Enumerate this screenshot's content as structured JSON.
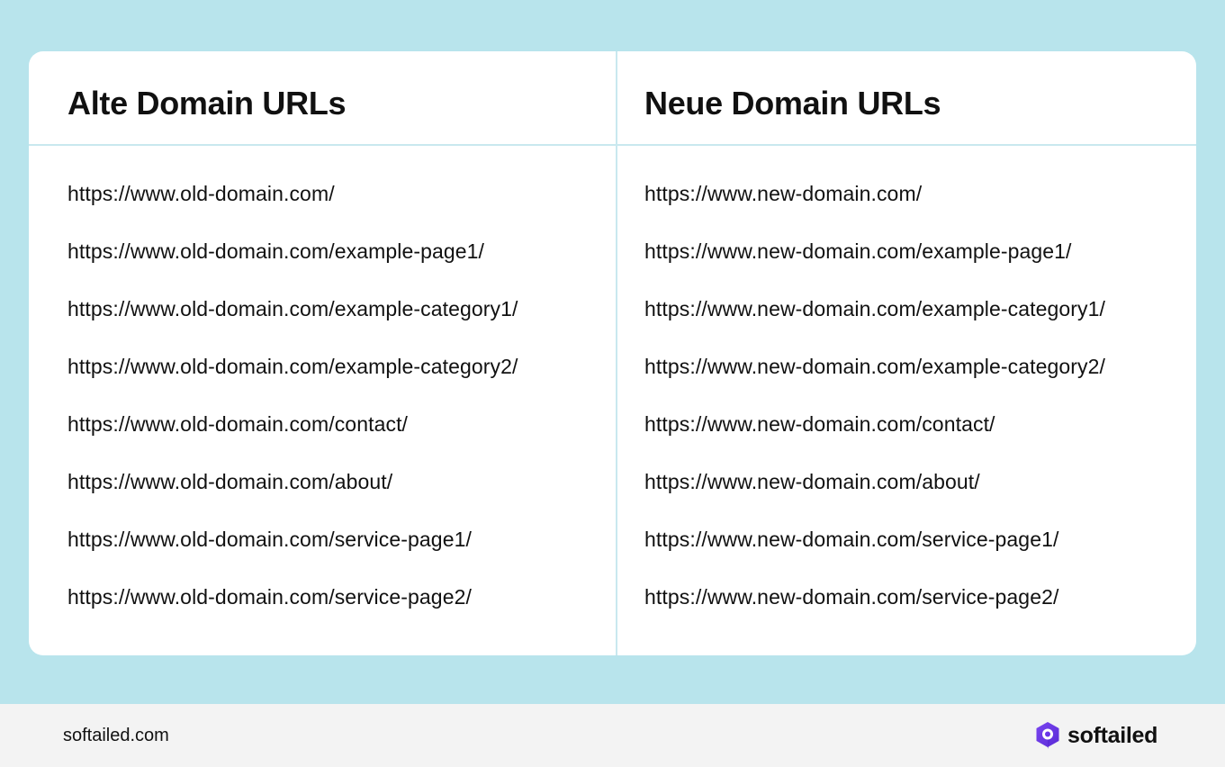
{
  "table": {
    "columns": [
      {
        "title": "Alte Domain URLs",
        "urls": [
          "https://www.old-domain.com/",
          "https://www.old-domain.com/example-page1/",
          "https://www.old-domain.com/example-category1/",
          "https://www.old-domain.com/example-category2/",
          "https://www.old-domain.com/contact/",
          "https://www.old-domain.com/about/",
          "https://www.old-domain.com/service-page1/",
          "https://www.old-domain.com/service-page2/"
        ]
      },
      {
        "title": "Neue Domain URLs",
        "urls": [
          "https://www.new-domain.com/",
          "https://www.new-domain.com/example-page1/",
          "https://www.new-domain.com/example-category1/",
          "https://www.new-domain.com/example-category2/",
          "https://www.new-domain.com/contact/",
          "https://www.new-domain.com/about/",
          "https://www.new-domain.com/service-page1/",
          "https://www.new-domain.com/service-page2/"
        ]
      }
    ]
  },
  "footer": {
    "domain": "softailed.com",
    "brand_name": "softailed",
    "brand_icon": "softailed-logo-icon"
  },
  "colors": {
    "background": "#b8e4ec",
    "divider": "#c9e8ef",
    "footer_background": "#f3f3f3",
    "logo_purple": "#6a35e8"
  }
}
